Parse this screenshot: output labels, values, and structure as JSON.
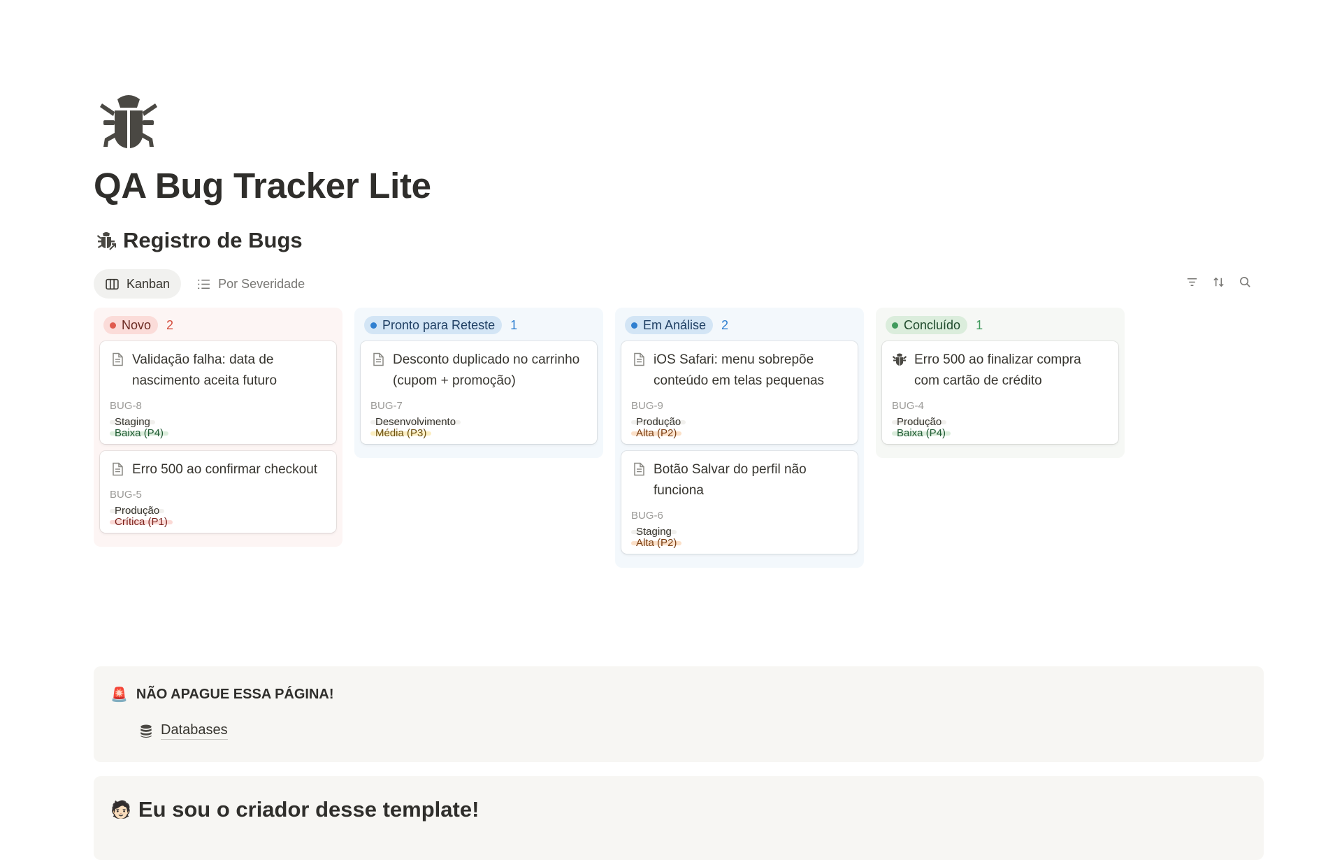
{
  "page": {
    "title": "QA Bug Tracker Lite",
    "icon": "bug-icon"
  },
  "database": {
    "title": "Registro de Bugs",
    "icon": "bug-link-icon"
  },
  "views": [
    {
      "label": "Kanban",
      "icon": "board-icon",
      "active": true
    },
    {
      "label": "Por Severidade",
      "icon": "list-icon",
      "active": false
    }
  ],
  "toolbar": {
    "filter_icon": "filter-icon",
    "sort_icon": "sort-icon",
    "search_icon": "search-icon"
  },
  "columns": [
    {
      "label": "Novo",
      "count": "2",
      "colors": {
        "bg": "#fdf5f4",
        "pill": "#fbdcd9",
        "dot": "#e05b4e",
        "text": "#6b2a22",
        "count": "#d44c3c"
      },
      "cards": [
        {
          "title": "Validação falha: data de nascimento aceita futuro",
          "id": "BUG-8",
          "env": "Staging",
          "severity": "Baixa (P4)",
          "icon": "document-icon"
        },
        {
          "title": "Erro 500 ao confirmar checkout",
          "id": "BUG-5",
          "env": "Produção",
          "severity": "Crítica (P1)",
          "icon": "document-icon"
        }
      ]
    },
    {
      "label": "Pronto para Reteste",
      "count": "1",
      "colors": {
        "bg": "#f3f8fc",
        "pill": "#d3e5f5",
        "dot": "#2f7fd0",
        "text": "#1f3f63",
        "count": "#2f7fd0"
      },
      "cards": [
        {
          "title": "Desconto duplicado no carrinho (cupom + promoção)",
          "id": "BUG-7",
          "env": "Desenvolvimento",
          "severity": "Média (P3)",
          "icon": "document-icon"
        }
      ]
    },
    {
      "label": "Em Análise",
      "count": "2",
      "colors": {
        "bg": "#f3f8fc",
        "pill": "#d3e5f5",
        "dot": "#2f7fd0",
        "text": "#1f3f63",
        "count": "#2f7fd0"
      },
      "cards": [
        {
          "title": "iOS Safari: menu sobrepõe conteúdo em telas pequenas",
          "id": "BUG-9",
          "env": "Produção",
          "severity": "Alta (P2)",
          "icon": "document-icon"
        },
        {
          "title": "Botão Salvar do perfil não funciona",
          "id": "BUG-6",
          "env": "Staging",
          "severity": "Alta (P2)",
          "icon": "document-icon"
        }
      ]
    },
    {
      "label": "Concluído",
      "count": "1",
      "colors": {
        "bg": "#f6f8f5",
        "pill": "#dbeddc",
        "dot": "#3f9a5c",
        "text": "#1f4a2c",
        "count": "#3f9a5c"
      },
      "cards": [
        {
          "title": "Erro 500 ao finalizar compra com cartão de crédito",
          "id": "BUG-4",
          "env": "Produção",
          "severity": "Baixa (P4)",
          "icon": "bug-icon"
        }
      ]
    }
  ],
  "severity_colors": {
    "Baixa (P4)": {
      "bg": "#dbeddc",
      "fg": "#1f5a33"
    },
    "Média (P3)": {
      "bg": "#fbeec1",
      "fg": "#6b4f10"
    },
    "Alta (P2)": {
      "bg": "#fbe0c8",
      "fg": "#7a3e12"
    },
    "Crítica (P1)": {
      "bg": "#fbd9d5",
      "fg": "#7a1f1a"
    }
  },
  "warning_callout": {
    "icon": "🚨",
    "text": "NÃO APAGUE ESSA PÁGINA!",
    "link_label": "Databases",
    "link_icon": "database-icon"
  },
  "creator_callout": {
    "icon": "🧑🏻",
    "text": "Eu sou o criador desse template!"
  }
}
